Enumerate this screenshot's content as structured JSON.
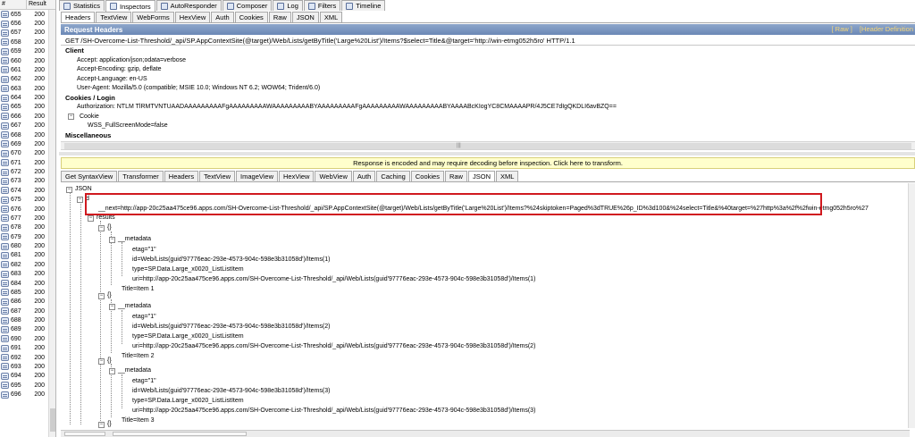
{
  "session_list": {
    "col_num": "#",
    "col_result": "Result",
    "rows": [
      {
        "num": "655",
        "result": "200"
      },
      {
        "num": "656",
        "result": "200"
      },
      {
        "num": "657",
        "result": "200"
      },
      {
        "num": "658",
        "result": "200"
      },
      {
        "num": "659",
        "result": "200"
      },
      {
        "num": "660",
        "result": "200"
      },
      {
        "num": "661",
        "result": "200"
      },
      {
        "num": "662",
        "result": "200"
      },
      {
        "num": "663",
        "result": "200"
      },
      {
        "num": "664",
        "result": "200"
      },
      {
        "num": "665",
        "result": "200"
      },
      {
        "num": "666",
        "result": "200"
      },
      {
        "num": "667",
        "result": "200"
      },
      {
        "num": "668",
        "result": "200"
      },
      {
        "num": "669",
        "result": "200"
      },
      {
        "num": "670",
        "result": "200"
      },
      {
        "num": "671",
        "result": "200"
      },
      {
        "num": "672",
        "result": "200"
      },
      {
        "num": "673",
        "result": "200"
      },
      {
        "num": "674",
        "result": "200"
      },
      {
        "num": "675",
        "result": "200"
      },
      {
        "num": "676",
        "result": "200"
      },
      {
        "num": "677",
        "result": "200"
      },
      {
        "num": "678",
        "result": "200"
      },
      {
        "num": "679",
        "result": "200"
      },
      {
        "num": "680",
        "result": "200"
      },
      {
        "num": "681",
        "result": "200"
      },
      {
        "num": "682",
        "result": "200"
      },
      {
        "num": "683",
        "result": "200"
      },
      {
        "num": "684",
        "result": "200"
      },
      {
        "num": "685",
        "result": "200"
      },
      {
        "num": "686",
        "result": "200"
      },
      {
        "num": "687",
        "result": "200"
      },
      {
        "num": "688",
        "result": "200"
      },
      {
        "num": "689",
        "result": "200"
      },
      {
        "num": "690",
        "result": "200"
      },
      {
        "num": "691",
        "result": "200"
      },
      {
        "num": "692",
        "result": "200"
      },
      {
        "num": "693",
        "result": "200"
      },
      {
        "num": "694",
        "result": "200"
      },
      {
        "num": "695",
        "result": "200"
      },
      {
        "num": "696",
        "result": "200"
      }
    ]
  },
  "top_tabs": [
    "Statistics",
    "Inspectors",
    "AutoResponder",
    "Composer",
    "Log",
    "Filters",
    "Timeline"
  ],
  "request_tabs": [
    "Headers",
    "TextView",
    "WebForms",
    "HexView",
    "Auth",
    "Cookies",
    "Raw",
    "JSON",
    "XML"
  ],
  "request": {
    "title": "Request Headers",
    "raw_link": "[ Raw ]",
    "header_def_link": "[Header Definition",
    "line": "GET /SH-Overcome-List-Threshold/_api/SP.AppContextSite(@target)/Web/Lists/getByTitle('Large%20List')/Items?$select=Title&@target='http://win-etmg052h5ro' HTTP/1.1",
    "client_label": "Client",
    "accept": "Accept: application/json;odata=verbose",
    "accept_encoding": "Accept-Encoding: gzip, deflate",
    "accept_language": "Accept-Language: en-US",
    "user_agent": "User-Agent: Mozilla/5.0 (compatible; MSIE 10.0; Windows NT 6.2; WOW64; Trident/6.0)",
    "cookies_label": "Cookies / Login",
    "authorization": "Authorization: NTLM TlRMTVNTUAADAAAAAAAAAFgAAAAAAAAAWAAAAAAAAABYAAAAAAAAAFgAAAAAAAAAWAAAAAAAAABYAAAABcKIogYC8CMAAAAPR/4J5CE7dIgQKDLI6avBZQ==",
    "cookie_label": "Cookie",
    "wss": "WSS_FullScreenMode=false",
    "misc_label": "Miscellaneous"
  },
  "notice": "Response is encoded and may require decoding before inspection. Click here to transform.",
  "response_tabs": [
    "Get SyntaxView",
    "Transformer",
    "Headers",
    "TextView",
    "ImageView",
    "HexView",
    "WebView",
    "Auth",
    "Caching",
    "Cookies",
    "Raw",
    "JSON",
    "XML"
  ],
  "tree": {
    "root": "JSON",
    "d": "d",
    "next": "__next=http://app-20c25aa475ce96.apps.com/SH-Overcome-List-Threshold/_api/SP.AppContextSite(@target)/Web/Lists/getByTitle('Large%20List')/Items?%24skiptoken=Paged%3dTRUE%26p_ID%3d100&%24select=Title&%40target=%27http%3a%2f%2fwin-etmg052h5ro%27",
    "results": "results",
    "obj": "{}",
    "metadata": "__metadata",
    "items": [
      {
        "etag": "etag=\"1\"",
        "id": "id=Web/Lists(guid'97776eac-293e-4573-904c-598e3b31058d')/Items(1)",
        "type": "type=SP.Data.Large_x0020_ListListItem",
        "uri": "uri=http://app-20c25aa475ce96.apps.com/SH-Overcome-List-Threshold/_api/Web/Lists(guid'97776eac-293e-4573-904c-598e3b31058d')/Items(1)",
        "title": "Title=Item 1"
      },
      {
        "etag": "etag=\"1\"",
        "id": "id=Web/Lists(guid'97776eac-293e-4573-904c-598e3b31058d')/Items(2)",
        "type": "type=SP.Data.Large_x0020_ListListItem",
        "uri": "uri=http://app-20c25aa475ce96.apps.com/SH-Overcome-List-Threshold/_api/Web/Lists(guid'97776eac-293e-4573-904c-598e3b31058d')/Items(2)",
        "title": "Title=Item 2"
      },
      {
        "etag": "etag=\"1\"",
        "id": "id=Web/Lists(guid'97776eac-293e-4573-904c-598e3b31058d')/Items(3)",
        "type": "type=SP.Data.Large_x0020_ListListItem",
        "uri": "uri=http://app-20c25aa475ce96.apps.com/SH-Overcome-List-Threshold/_api/Web/Lists(guid'97776eac-293e-4573-904c-598e3b31058d')/Items(3)",
        "title": "Title=Item 3"
      }
    ]
  },
  "colors": {
    "highlight": "#d0191f",
    "title_bar": "#7a95bf",
    "notice_bg": "#ffffcc",
    "link": "#f4d67a"
  }
}
